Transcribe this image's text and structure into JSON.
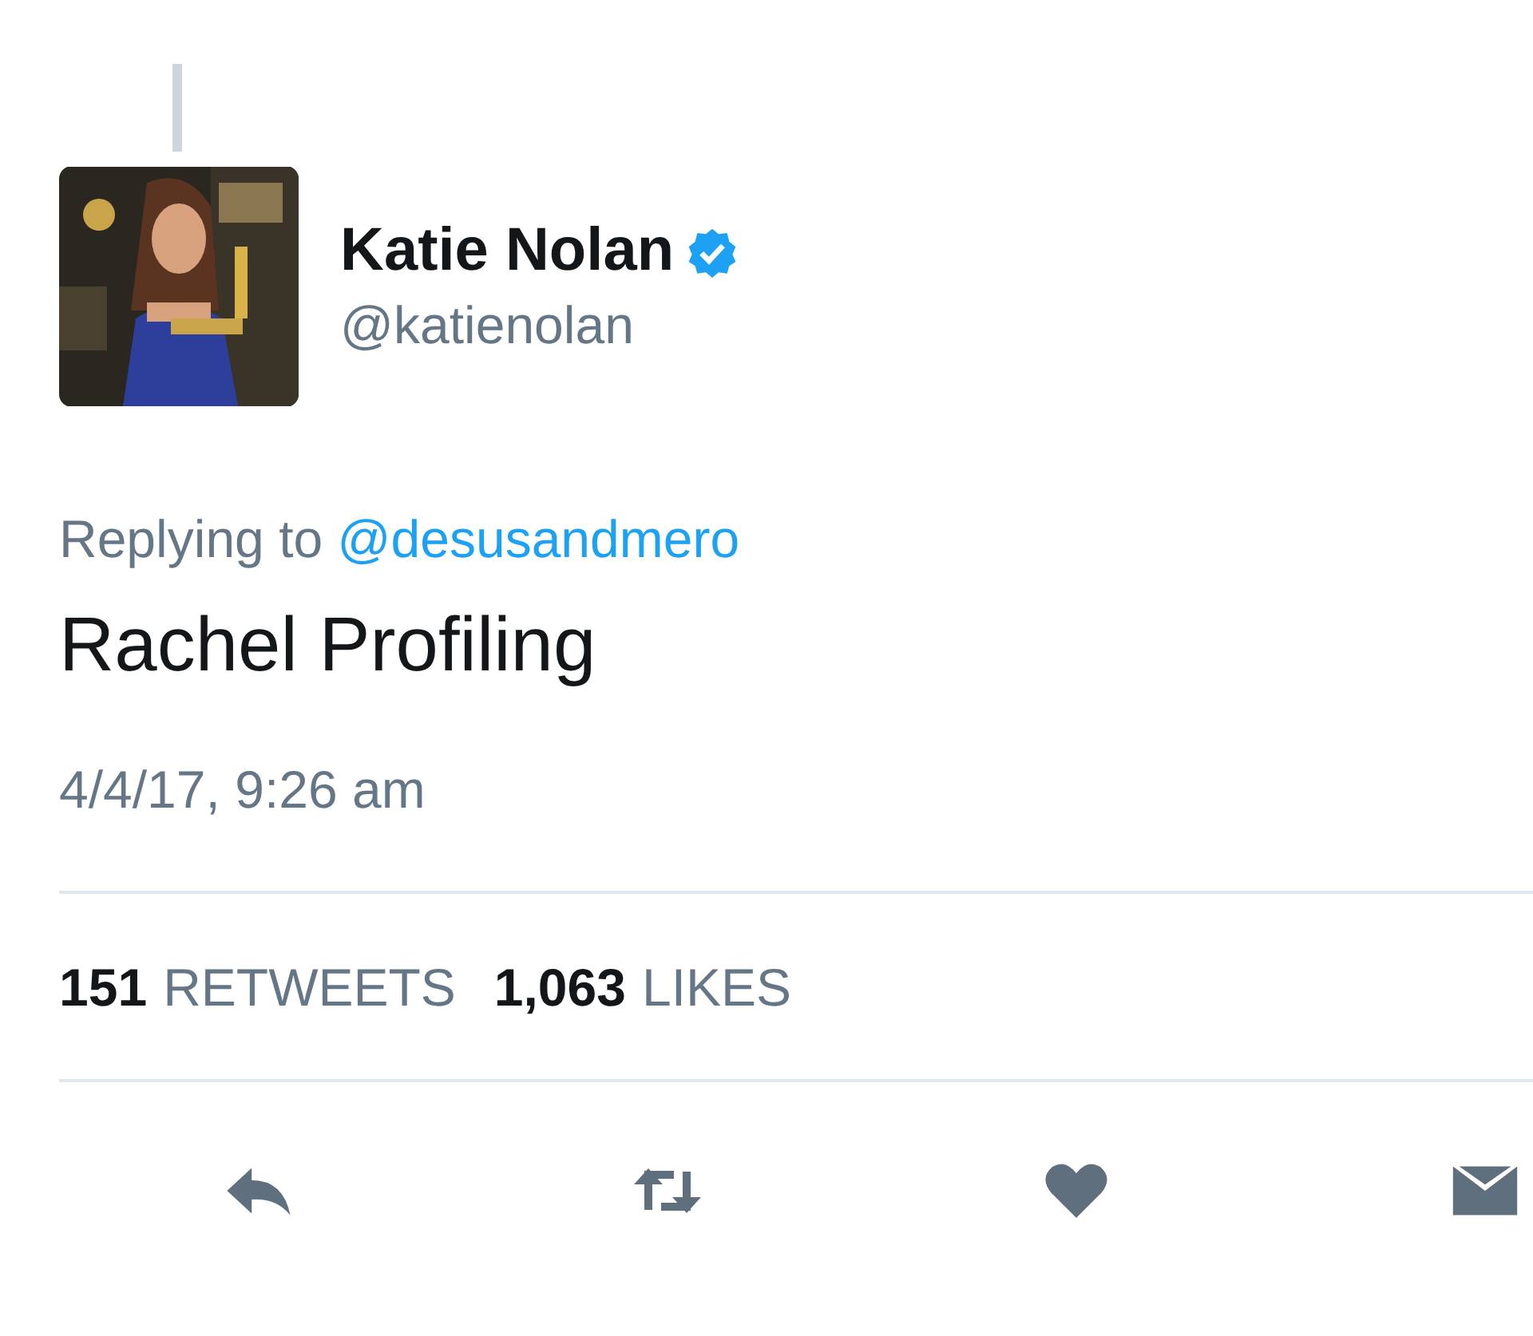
{
  "tweet": {
    "author": {
      "name": "Katie Nolan",
      "verified": true,
      "handle": "@katienolan"
    },
    "reply_to": {
      "label": "Replying to",
      "handle": "@desusandmero"
    },
    "text": "Rachel Profiling",
    "timestamp": "4/4/17, 9:26 am",
    "stats": [
      {
        "count": "151",
        "label": "RETWEETS"
      },
      {
        "count": "1,063",
        "label": "LIKES"
      }
    ]
  }
}
